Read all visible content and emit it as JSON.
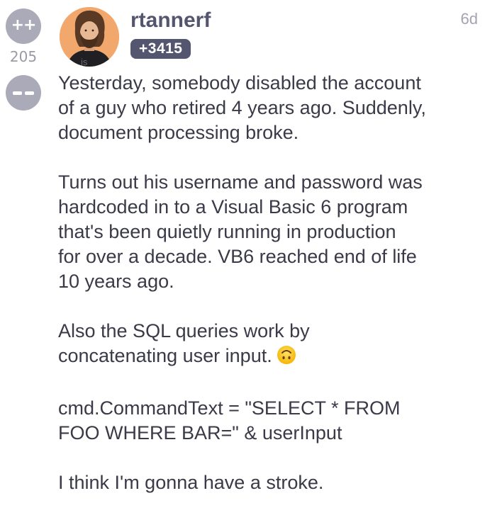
{
  "vote": {
    "up_label": "++",
    "score": "205"
  },
  "post": {
    "username": "rtannerf",
    "reputation": "+3415",
    "time_ago": "6d",
    "avatar_tag": "js",
    "paragraphs": [
      {
        "lines": [
          "Yesterday, somebody disabled the account",
          "of a guy who retired 4 years ago. Suddenly,",
          "document processing broke."
        ]
      },
      {
        "lines": [
          "Turns out his username and password was",
          "hardcoded in to a Visual Basic 6 program",
          "that's been quietly running in production",
          "for over a decade. VB6 reached end of life",
          "10 years ago."
        ]
      },
      {
        "lines": [
          "Also the SQL queries work by",
          "concatenating user input."
        ],
        "trailing_icon": "upside-down-face-emoji"
      },
      {
        "lines": [
          "cmd.CommandText = \"SELECT * FROM",
          "FOO WHERE BAR=\" & userInput"
        ]
      },
      {
        "lines": [
          "I think I'm gonna have a stroke."
        ]
      }
    ]
  },
  "colors": {
    "vote_button": "#aaaab8",
    "username": "#54556e",
    "badge_bg": "#54556e",
    "text": "#3a3a48",
    "muted": "#a3a3b2",
    "avatar_bg": "#f2a86c"
  }
}
